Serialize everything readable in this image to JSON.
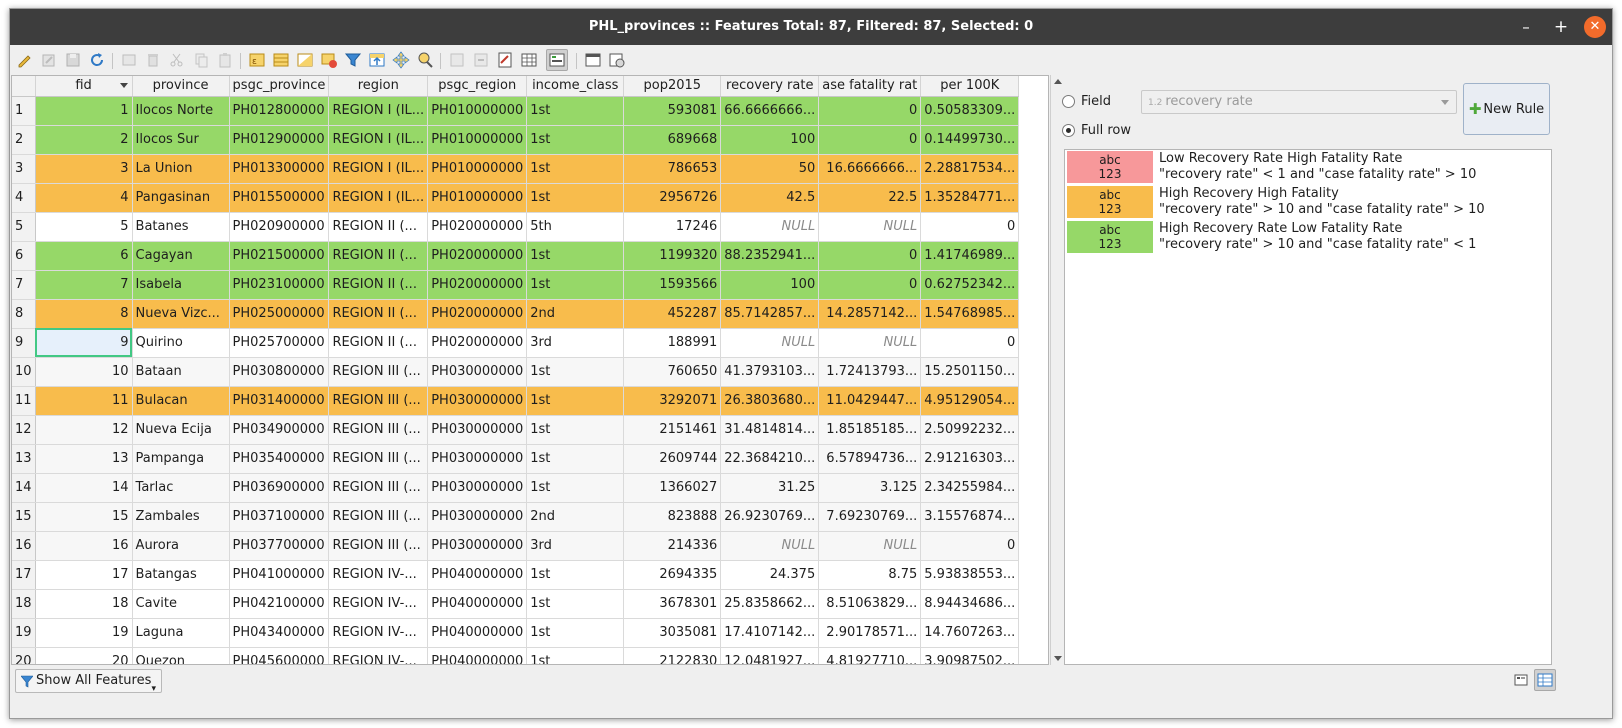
{
  "window": {
    "title": "PHL_provinces :: Features Total: 87, Filtered: 87, Selected: 0",
    "minimize": "–",
    "maximize": "+",
    "close": "✕"
  },
  "toolbar": {
    "icons": [
      "toggle-edit-icon",
      "edit-multiple-icon",
      "save-edits-icon",
      "reload-icon",
      "add-feature-icon",
      "delete-feature-icon",
      "cut-icon",
      "copy-icon",
      "paste-icon",
      "expression-select-icon",
      "select-all-icon",
      "invert-selection-icon",
      "deselect-all-icon",
      "filter-selection-icon",
      "move-selection-top-icon",
      "pan-to-selection-icon",
      "zoom-to-selection-icon",
      "new-field-icon",
      "delete-field-icon",
      "field-calculator-icon",
      "conditional-formatting-icon",
      "dock-icon",
      "actions-icon"
    ]
  },
  "table": {
    "columns": [
      "fid",
      "province",
      "psgc_province",
      "region",
      "psgc_region",
      "income_class",
      "pop2015",
      "recovery rate",
      "ase fatality rat",
      "per 100K"
    ],
    "rows": [
      {
        "n": "1",
        "fid": "1",
        "province": "Ilocos Norte",
        "psgc_province": "PH012800000",
        "region": "REGION I (IL...",
        "psgc_region": "PH010000000",
        "income": "1st",
        "pop": "593081",
        "rec": "66.6666666...",
        "cfr": "0",
        "p100k": "0.50583309...",
        "style": "green"
      },
      {
        "n": "2",
        "fid": "2",
        "province": "Ilocos Sur",
        "psgc_province": "PH012900000",
        "region": "REGION I (IL...",
        "psgc_region": "PH010000000",
        "income": "1st",
        "pop": "689668",
        "rec": "100",
        "cfr": "0",
        "p100k": "0.14499730...",
        "style": "green"
      },
      {
        "n": "3",
        "fid": "3",
        "province": "La Union",
        "psgc_province": "PH013300000",
        "region": "REGION I (IL...",
        "psgc_region": "PH010000000",
        "income": "1st",
        "pop": "786653",
        "rec": "50",
        "cfr": "16.6666666...",
        "p100k": "2.28817534...",
        "style": "orange"
      },
      {
        "n": "4",
        "fid": "4",
        "province": "Pangasinan",
        "psgc_province": "PH015500000",
        "region": "REGION I (IL...",
        "psgc_region": "PH010000000",
        "income": "1st",
        "pop": "2956726",
        "rec": "42.5",
        "cfr": "22.5",
        "p100k": "1.35284771...",
        "style": "orange"
      },
      {
        "n": "5",
        "fid": "5",
        "province": "Batanes",
        "psgc_province": "PH020900000",
        "region": "REGION II (...",
        "psgc_region": "PH020000000",
        "income": "5th",
        "pop": "17246",
        "rec": "NULL",
        "cfr": "NULL",
        "p100k": "0",
        "style": "white"
      },
      {
        "n": "6",
        "fid": "6",
        "province": "Cagayan",
        "psgc_province": "PH021500000",
        "region": "REGION II (...",
        "psgc_region": "PH020000000",
        "income": "1st",
        "pop": "1199320",
        "rec": "88.2352941...",
        "cfr": "0",
        "p100k": "1.41746989...",
        "style": "green"
      },
      {
        "n": "7",
        "fid": "7",
        "province": "Isabela",
        "psgc_province": "PH023100000",
        "region": "REGION II (...",
        "psgc_region": "PH020000000",
        "income": "1st",
        "pop": "1593566",
        "rec": "100",
        "cfr": "0",
        "p100k": "0.62752342...",
        "style": "green"
      },
      {
        "n": "8",
        "fid": "8",
        "province": "Nueva Vizc...",
        "psgc_province": "PH025000000",
        "region": "REGION II (...",
        "psgc_region": "PH020000000",
        "income": "2nd",
        "pop": "452287",
        "rec": "85.7142857...",
        "cfr": "14.2857142...",
        "p100k": "1.54768985...",
        "style": "orange"
      },
      {
        "n": "9",
        "fid": "9",
        "province": "Quirino",
        "psgc_province": "PH025700000",
        "region": "REGION II (...",
        "psgc_region": "PH020000000",
        "income": "3rd",
        "pop": "188991",
        "rec": "NULL",
        "cfr": "NULL",
        "p100k": "0",
        "style": "white"
      },
      {
        "n": "10",
        "fid": "10",
        "province": "Bataan",
        "psgc_province": "PH030800000",
        "region": "REGION III (...",
        "psgc_region": "PH030000000",
        "income": "1st",
        "pop": "760650",
        "rec": "41.3793103...",
        "cfr": "1.72413793...",
        "p100k": "15.2501150...",
        "style": "alt"
      },
      {
        "n": "11",
        "fid": "11",
        "province": "Bulacan",
        "psgc_province": "PH031400000",
        "region": "REGION III (...",
        "psgc_region": "PH030000000",
        "income": "1st",
        "pop": "3292071",
        "rec": "26.3803680...",
        "cfr": "11.0429447...",
        "p100k": "4.95129054...",
        "style": "orange"
      },
      {
        "n": "12",
        "fid": "12",
        "province": "Nueva Ecija",
        "psgc_province": "PH034900000",
        "region": "REGION III (...",
        "psgc_region": "PH030000000",
        "income": "1st",
        "pop": "2151461",
        "rec": "31.4814814...",
        "cfr": "1.85185185...",
        "p100k": "2.50992232...",
        "style": "alt"
      },
      {
        "n": "13",
        "fid": "13",
        "province": "Pampanga",
        "psgc_province": "PH035400000",
        "region": "REGION III (...",
        "psgc_region": "PH030000000",
        "income": "1st",
        "pop": "2609744",
        "rec": "22.3684210...",
        "cfr": "6.57894736...",
        "p100k": "2.91216303...",
        "style": "alt"
      },
      {
        "n": "14",
        "fid": "14",
        "province": "Tarlac",
        "psgc_province": "PH036900000",
        "region": "REGION III (...",
        "psgc_region": "PH030000000",
        "income": "1st",
        "pop": "1366027",
        "rec": "31.25",
        "cfr": "3.125",
        "p100k": "2.34255984...",
        "style": "alt"
      },
      {
        "n": "15",
        "fid": "15",
        "province": "Zambales",
        "psgc_province": "PH037100000",
        "region": "REGION III (...",
        "psgc_region": "PH030000000",
        "income": "2nd",
        "pop": "823888",
        "rec": "26.9230769...",
        "cfr": "7.69230769...",
        "p100k": "3.15576874...",
        "style": "alt"
      },
      {
        "n": "16",
        "fid": "16",
        "province": "Aurora",
        "psgc_province": "PH037700000",
        "region": "REGION III (...",
        "psgc_region": "PH030000000",
        "income": "3rd",
        "pop": "214336",
        "rec": "NULL",
        "cfr": "NULL",
        "p100k": "0",
        "style": "alt"
      },
      {
        "n": "17",
        "fid": "17",
        "province": "Batangas",
        "psgc_province": "PH041000000",
        "region": "REGION IV-...",
        "psgc_region": "PH040000000",
        "income": "1st",
        "pop": "2694335",
        "rec": "24.375",
        "cfr": "8.75",
        "p100k": "5.93838553...",
        "style": "white"
      },
      {
        "n": "18",
        "fid": "18",
        "province": "Cavite",
        "psgc_province": "PH042100000",
        "region": "REGION IV-...",
        "psgc_region": "PH040000000",
        "income": "1st",
        "pop": "3678301",
        "rec": "25.8358662...",
        "cfr": "8.51063829...",
        "p100k": "8.94434686...",
        "style": "white"
      },
      {
        "n": "19",
        "fid": "19",
        "province": "Laguna",
        "psgc_province": "PH043400000",
        "region": "REGION IV-...",
        "psgc_region": "PH040000000",
        "income": "1st",
        "pop": "3035081",
        "rec": "17.4107142...",
        "cfr": "2.90178571...",
        "p100k": "14.7607263...",
        "style": "white"
      },
      {
        "n": "20",
        "fid": "20",
        "province": "Quezon",
        "psgc_province": "PH045600000",
        "region": "REGION IV-...",
        "psgc_region": "PH040000000",
        "income": "1st",
        "pop": "2122830",
        "rec": "12.0481927...",
        "cfr": "4.81927710...",
        "p100k": "3.90987502...",
        "style": "white"
      }
    ],
    "current_row": "9"
  },
  "format_panel": {
    "field_label": "Field",
    "fullrow_label": "Full row",
    "field_selected": "fullrow",
    "field_combo_prefix": "1.2",
    "field_combo_value": "recovery rate",
    "new_rule_label": "New Rule",
    "rules": [
      {
        "swatch_text_1": "abc",
        "swatch_text_2": "123",
        "name": "Low Recovery Rate High Fatality Rate",
        "expr": " \"recovery rate\" < 1 and  \"case fatality rate\" > 10",
        "color": "#f7989a"
      },
      {
        "swatch_text_1": "abc",
        "swatch_text_2": "123",
        "name": "High Recovery High Fatality",
        "expr": " \"recovery rate\" > 10 and  \"case fatality rate\" > 10",
        "color": "#f8bc4c"
      },
      {
        "swatch_text_1": "abc",
        "swatch_text_2": "123",
        "name": "High Recovery Rate Low Fatality Rate",
        "expr": " \"recovery rate\" > 10 and  \"case fatality rate\" < 1",
        "color": "#96d868"
      }
    ]
  },
  "bottom": {
    "filter_button": "Show All Features"
  },
  "colors": {
    "green": "#96d868",
    "orange": "#f8bc4c",
    "pink": "#f7989a",
    "titlebar": "#3d3d3d",
    "close": "#f26b2b"
  }
}
